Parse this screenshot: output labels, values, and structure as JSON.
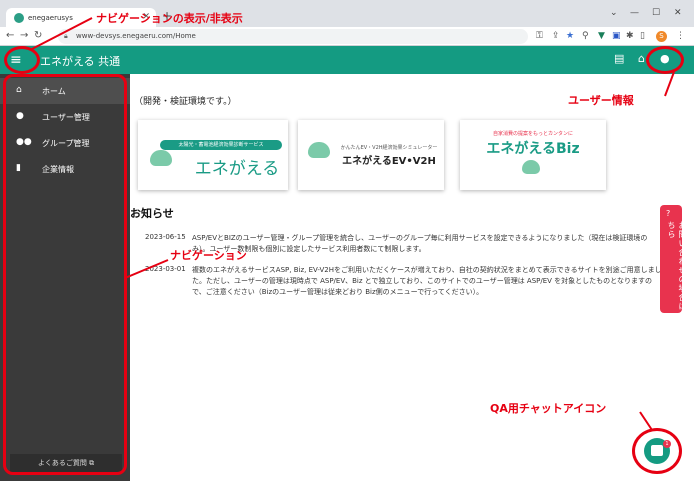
{
  "browser": {
    "tab_title": "enegaerusys",
    "url": "www-devsys.enegaeru.com/Home",
    "profile_initial": "S"
  },
  "header": {
    "app_title": "エネがえる 共通",
    "menu_icon": "menu-icon",
    "manual_icon": "book-icon",
    "home_icon": "home-icon",
    "user_icon": "person-icon"
  },
  "sidebar": {
    "items": [
      {
        "label": "ホーム",
        "icon": "home-icon"
      },
      {
        "label": "ユーザー管理",
        "icon": "person-icon"
      },
      {
        "label": "グループ管理",
        "icon": "group-icon"
      },
      {
        "label": "企業情報",
        "icon": "building-icon"
      }
    ],
    "faq_label": "よくあるご質問 ⧉"
  },
  "main": {
    "env_note": "（開発・検証環境です。）",
    "cards": [
      {
        "ribbon": "太陽光・蓄電池経済効果診断サービス",
        "title": "エネがえる"
      },
      {
        "subtitle": "かんたんEV・V2H経済効果シミュレーター",
        "title": "エネがえるEV•V2H"
      },
      {
        "subtitle": "自家消費の提案をもっとカンタンに",
        "title": "エネがえるBiz"
      }
    ],
    "news_title": "お知らせ",
    "news": [
      {
        "date": "2023-06-15",
        "text": "ASP/EVとBIZのユーザー管理・グループ管理を統合し、ユーザーのグループ毎に利用サービスを設定できるようになりました（現在は検証環境のみ）。ユーザー数制限も個別に設定したサービス利用者数にて制限します。"
      },
      {
        "date": "2023-03-01",
        "text": "複数のエネがえるサービスASP, Biz, EV-V2Hをご利用いただくケースが増えており、自社の契約状況をまとめて表示できるサイトを別途ご用意しました。ただし、ユーザーの管理は現時点で ASP/EV、Biz とで独立しており、このサイトでのユーザー管理は ASP/EV を対象としたものとなりますので、ご注意ください（Bizのユーザー管理は従来どおり Biz側のメニューで行ってください）。"
      }
    ],
    "side_tab": "お問い合わせの場合はこちら",
    "chat_badge": "1"
  },
  "annotations": {
    "nav_toggle": "ナビゲーションの表示/非表示",
    "user_info": "ユーザー情報",
    "navigation": "ナビゲーション",
    "qa_chat": "QA用チャットアイコン"
  },
  "colors": {
    "brand": "#149b82",
    "annotation": "#e60012",
    "sidebar": "#3a3a3a"
  }
}
